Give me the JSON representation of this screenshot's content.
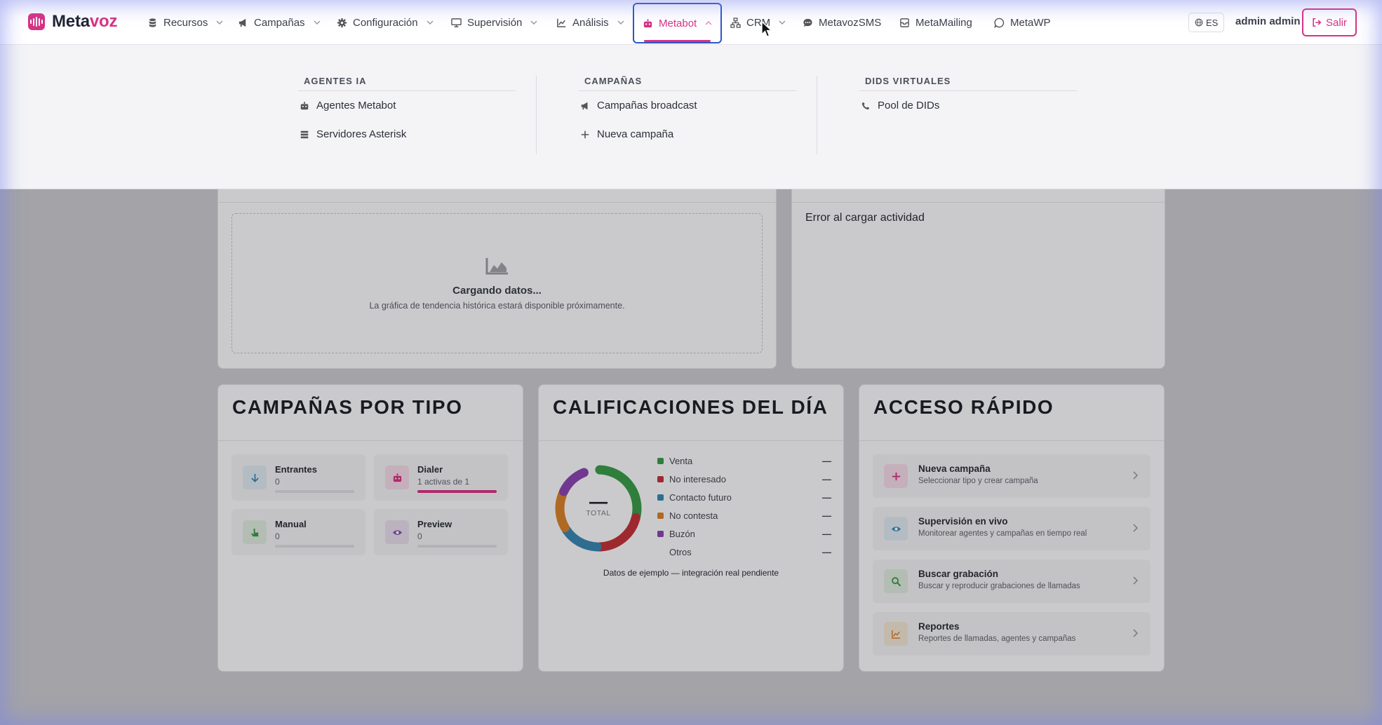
{
  "brand": {
    "name_main": "Meta",
    "name_accent": "voz"
  },
  "nav": {
    "recursos": "Recursos",
    "campanas": "Campañas",
    "configuracion": "Configuración",
    "supervision": "Supervisión",
    "analisis": "Análisis",
    "metabot": "Metabot",
    "crm": "CRM",
    "sms": "MetavozSMS",
    "mailing": "MetaMailing",
    "wp": "MetaWP",
    "lang": "ES",
    "user": "admin admin",
    "logout": "Salir"
  },
  "mega_menu": {
    "agentes_ia": {
      "heading": "AGENTES IA",
      "items": [
        "Agentes Metabot",
        "Servidores Asterisk"
      ]
    },
    "campanas": {
      "heading": "CAMPAÑAS",
      "items": [
        "Campañas broadcast",
        "Nueva campaña"
      ]
    },
    "dids": {
      "heading": "DIDS VIRTUALES",
      "items": [
        "Pool de DIDs"
      ]
    }
  },
  "trend": {
    "loading": "Cargando datos...",
    "note": "La gráfica de tendencia histórica estará disponible próximamente."
  },
  "activity": {
    "error": "Error al cargar actividad"
  },
  "campaign_types": {
    "title": "CAMPAÑAS POR TIPO",
    "items": [
      {
        "name": "Entrantes",
        "count": "0",
        "fill": 0
      },
      {
        "name": "Dialer",
        "count": "1 activas de 1",
        "fill": 1
      },
      {
        "name": "Manual",
        "count": "0",
        "fill": 0
      },
      {
        "name": "Preview",
        "count": "0",
        "fill": 0
      }
    ]
  },
  "calificaciones": {
    "title": "CALIFICACIONES DEL DÍA",
    "center_value": "—",
    "center_label": "TOTAL",
    "legend": [
      {
        "label": "Venta",
        "value": "—",
        "color": "#3a9a48"
      },
      {
        "label": "No interesado",
        "value": "—",
        "color": "#c0333a"
      },
      {
        "label": "Contacto futuro",
        "value": "—",
        "color": "#3a86b0"
      },
      {
        "label": "No contesta",
        "value": "—",
        "color": "#d6802a"
      },
      {
        "label": "Buzón",
        "value": "—",
        "color": "#8a45b0"
      },
      {
        "label": "Otros",
        "value": "—",
        "color": ""
      }
    ],
    "note": "Datos de ejemplo — integración real pendiente"
  },
  "quick_access": {
    "title": "ACCESO RÁPIDO",
    "items": [
      {
        "name": "Nueva campaña",
        "desc": "Seleccionar tipo y crear campaña"
      },
      {
        "name": "Supervisión en vivo",
        "desc": "Monitorear agentes y campañas en tiempo real"
      },
      {
        "name": "Buscar grabación",
        "desc": "Buscar y reproducir grabaciones de llamadas"
      },
      {
        "name": "Reportes",
        "desc": "Reportes de llamadas, agentes y campañas"
      }
    ]
  },
  "colors": {
    "accent": "#d63384",
    "focus_ring": "#2d55c8"
  }
}
